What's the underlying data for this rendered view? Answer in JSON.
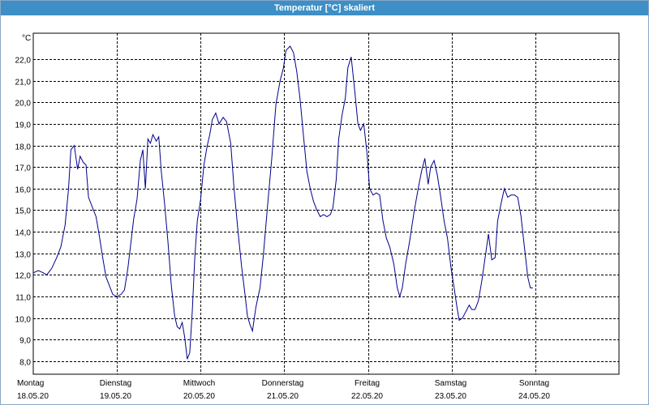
{
  "window": {
    "title": "Temperatur [°C] skaliert"
  },
  "chart_data": {
    "type": "line",
    "title": "Temperatur [°C] skaliert",
    "ylabel": "°C",
    "xlabel": "",
    "ylim": [
      7.4,
      23.2
    ],
    "y_ticks": [
      "8,0",
      "9,0",
      "10,0",
      "11,0",
      "12,0",
      "13,0",
      "14,0",
      "15,0",
      "16,0",
      "17,0",
      "18,0",
      "19,0",
      "20,0",
      "21,0",
      "22,0"
    ],
    "y_tick_values": [
      8,
      9,
      10,
      11,
      12,
      13,
      14,
      15,
      16,
      17,
      18,
      19,
      20,
      21,
      22
    ],
    "x_range": [
      0,
      7
    ],
    "day_labels": [
      {
        "day": "Montag",
        "date": "18.05.20"
      },
      {
        "day": "Dienstag",
        "date": "19.05.20"
      },
      {
        "day": "Mittwoch",
        "date": "20.05.20"
      },
      {
        "day": "Donnerstag",
        "date": "21.05.20"
      },
      {
        "day": "Freitag",
        "date": "22.05.20"
      },
      {
        "day": "Samstag",
        "date": "23.05.20"
      },
      {
        "day": "Sonntag",
        "date": "24.05.20"
      }
    ],
    "grid": true,
    "line_color": "#00008b",
    "series": [
      {
        "points": [
          [
            0.0,
            12.1
          ],
          [
            0.06,
            12.2
          ],
          [
            0.12,
            12.1
          ],
          [
            0.16,
            12.0
          ],
          [
            0.22,
            12.3
          ],
          [
            0.28,
            12.8
          ],
          [
            0.33,
            13.3
          ],
          [
            0.38,
            14.3
          ],
          [
            0.42,
            15.9
          ],
          [
            0.45,
            17.8
          ],
          [
            0.49,
            18.0
          ],
          [
            0.53,
            16.9
          ],
          [
            0.56,
            17.5
          ],
          [
            0.6,
            17.2
          ],
          [
            0.63,
            17.1
          ],
          [
            0.66,
            15.6
          ],
          [
            0.71,
            15.1
          ],
          [
            0.75,
            14.7
          ],
          [
            0.79,
            13.8
          ],
          [
            0.83,
            12.8
          ],
          [
            0.87,
            11.9
          ],
          [
            0.91,
            11.5
          ],
          [
            0.95,
            11.1
          ],
          [
            1.0,
            11.0
          ],
          [
            1.05,
            11.1
          ],
          [
            1.09,
            11.3
          ],
          [
            1.13,
            12.3
          ],
          [
            1.17,
            13.6
          ],
          [
            1.2,
            14.6
          ],
          [
            1.24,
            15.5
          ],
          [
            1.28,
            17.3
          ],
          [
            1.31,
            17.8
          ],
          [
            1.34,
            16.0
          ],
          [
            1.37,
            18.3
          ],
          [
            1.4,
            18.1
          ],
          [
            1.43,
            18.5
          ],
          [
            1.47,
            18.2
          ],
          [
            1.5,
            18.4
          ],
          [
            1.53,
            16.8
          ],
          [
            1.57,
            15.3
          ],
          [
            1.61,
            13.5
          ],
          [
            1.65,
            11.5
          ],
          [
            1.69,
            10.1
          ],
          [
            1.72,
            9.6
          ],
          [
            1.75,
            9.5
          ],
          [
            1.78,
            9.8
          ],
          [
            1.81,
            9.1
          ],
          [
            1.84,
            8.1
          ],
          [
            1.87,
            8.4
          ],
          [
            1.9,
            10.3
          ],
          [
            1.93,
            12.8
          ],
          [
            1.96,
            14.5
          ],
          [
            2.0,
            15.5
          ],
          [
            2.04,
            17.1
          ],
          [
            2.08,
            18.0
          ],
          [
            2.11,
            18.5
          ],
          [
            2.14,
            19.2
          ],
          [
            2.18,
            19.5
          ],
          [
            2.22,
            19.0
          ],
          [
            2.27,
            19.3
          ],
          [
            2.31,
            19.1
          ],
          [
            2.36,
            18.1
          ],
          [
            2.4,
            16.0
          ],
          [
            2.45,
            13.9
          ],
          [
            2.49,
            12.4
          ],
          [
            2.53,
            11.1
          ],
          [
            2.56,
            10.1
          ],
          [
            2.59,
            9.7
          ],
          [
            2.62,
            9.4
          ],
          [
            2.66,
            10.5
          ],
          [
            2.71,
            11.4
          ],
          [
            2.75,
            12.9
          ],
          [
            2.8,
            15.2
          ],
          [
            2.85,
            17.4
          ],
          [
            2.9,
            19.9
          ],
          [
            2.95,
            21.0
          ],
          [
            2.99,
            21.6
          ],
          [
            3.02,
            22.4
          ],
          [
            3.07,
            22.6
          ],
          [
            3.11,
            22.3
          ],
          [
            3.15,
            21.4
          ],
          [
            3.19,
            20.1
          ],
          [
            3.23,
            18.4
          ],
          [
            3.27,
            16.8
          ],
          [
            3.31,
            16.0
          ],
          [
            3.35,
            15.4
          ],
          [
            3.39,
            15.0
          ],
          [
            3.43,
            14.7
          ],
          [
            3.47,
            14.8
          ],
          [
            3.51,
            14.7
          ],
          [
            3.55,
            14.8
          ],
          [
            3.58,
            15.1
          ],
          [
            3.62,
            16.4
          ],
          [
            3.65,
            18.3
          ],
          [
            3.69,
            19.4
          ],
          [
            3.73,
            20.2
          ],
          [
            3.76,
            21.6
          ],
          [
            3.8,
            22.1
          ],
          [
            3.84,
            20.6
          ],
          [
            3.88,
            19.0
          ],
          [
            3.91,
            18.7
          ],
          [
            3.95,
            19.0
          ],
          [
            3.99,
            17.6
          ],
          [
            4.02,
            16.0
          ],
          [
            4.06,
            15.7
          ],
          [
            4.1,
            15.8
          ],
          [
            4.14,
            15.7
          ],
          [
            4.18,
            14.5
          ],
          [
            4.22,
            13.7
          ],
          [
            4.26,
            13.3
          ],
          [
            4.31,
            12.5
          ],
          [
            4.35,
            11.4
          ],
          [
            4.38,
            11.0
          ],
          [
            4.41,
            11.4
          ],
          [
            4.45,
            12.5
          ],
          [
            4.5,
            13.6
          ],
          [
            4.55,
            14.9
          ],
          [
            4.6,
            16.0
          ],
          [
            4.64,
            16.8
          ],
          [
            4.68,
            17.4
          ],
          [
            4.72,
            16.2
          ],
          [
            4.75,
            17.0
          ],
          [
            4.79,
            17.3
          ],
          [
            4.83,
            16.6
          ],
          [
            4.87,
            15.6
          ],
          [
            4.91,
            14.5
          ],
          [
            4.95,
            13.7
          ],
          [
            4.99,
            12.4
          ],
          [
            5.03,
            11.4
          ],
          [
            5.06,
            10.6
          ],
          [
            5.09,
            9.9
          ],
          [
            5.13,
            10.0
          ],
          [
            5.17,
            10.3
          ],
          [
            5.21,
            10.6
          ],
          [
            5.24,
            10.4
          ],
          [
            5.28,
            10.4
          ],
          [
            5.32,
            10.8
          ],
          [
            5.36,
            11.7
          ],
          [
            5.4,
            12.8
          ],
          [
            5.44,
            13.9
          ],
          [
            5.48,
            12.7
          ],
          [
            5.52,
            12.8
          ],
          [
            5.55,
            14.5
          ],
          [
            5.59,
            15.3
          ],
          [
            5.63,
            16.0
          ],
          [
            5.67,
            15.6
          ],
          [
            5.71,
            15.7
          ],
          [
            5.75,
            15.7
          ],
          [
            5.79,
            15.6
          ],
          [
            5.83,
            14.7
          ],
          [
            5.87,
            13.3
          ],
          [
            5.91,
            11.9
          ],
          [
            5.94,
            11.4
          ],
          [
            5.97,
            11.4
          ]
        ]
      }
    ]
  }
}
